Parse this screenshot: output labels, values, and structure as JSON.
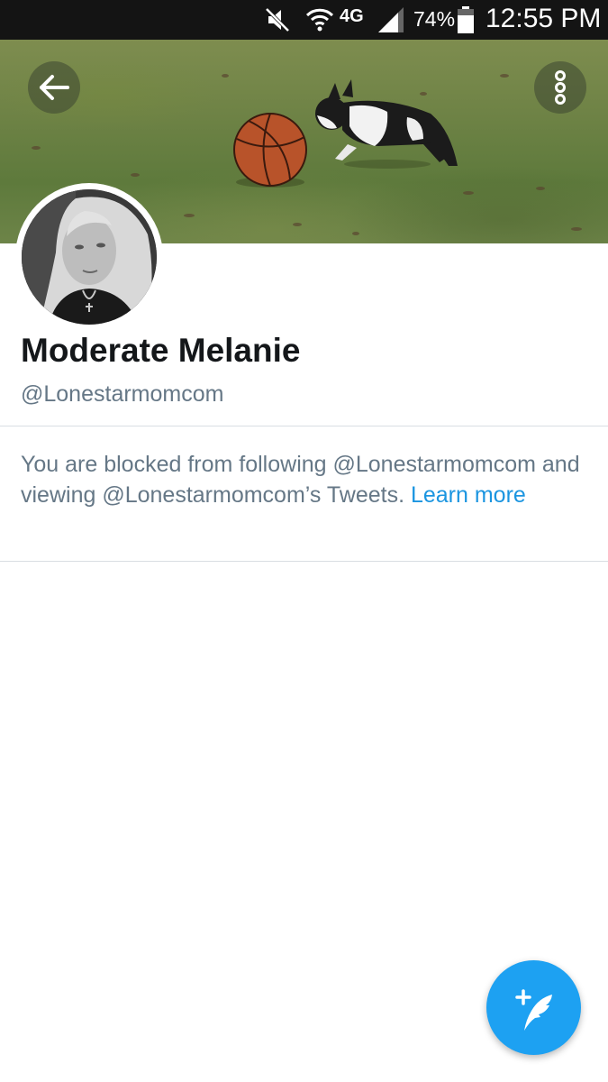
{
  "status_bar": {
    "network_label": "4G",
    "battery_percent": "74%",
    "time": "12:55 PM",
    "icons": [
      "mute-icon",
      "wifi-icon",
      "lte-icon",
      "signal-icon",
      "battery-icon"
    ]
  },
  "profile": {
    "display_name": "Moderate Melanie",
    "handle": "@Lonestarmomcom",
    "blocked_text": "You are blocked from following @Lonestarmomcom and viewing @Lonestarmomcom’s Tweets.",
    "learn_more_label": "Learn more"
  },
  "icons": {
    "back": "back-arrow-icon",
    "more": "more-options-icon",
    "compose": "compose-tweet-icon"
  },
  "colors": {
    "accent": "#1da1f2",
    "link": "#1b95e0",
    "secondary_text": "#657786",
    "primary_text": "#14171a",
    "status_bar_bg": "#141414"
  }
}
